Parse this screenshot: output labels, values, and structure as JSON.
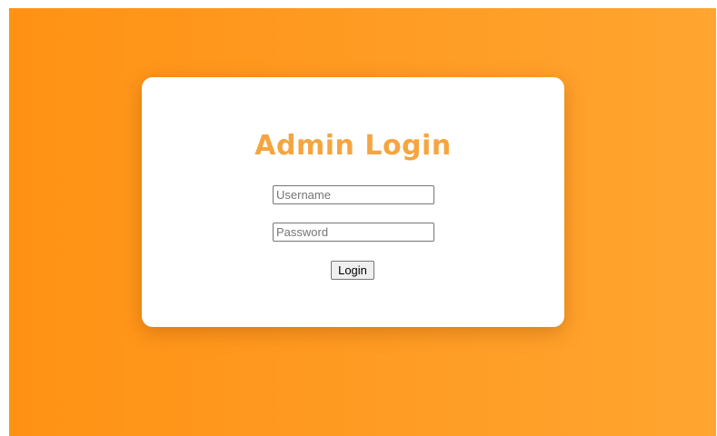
{
  "login_form": {
    "title": "Admin Login",
    "username": {
      "value": "",
      "placeholder": "Username"
    },
    "password": {
      "value": "",
      "placeholder": "Password"
    },
    "submit_label": "Login"
  },
  "colors": {
    "background_start": "#ff9214",
    "background_end": "#ffa530",
    "card": "#ffffff",
    "title": "#f5a540"
  }
}
